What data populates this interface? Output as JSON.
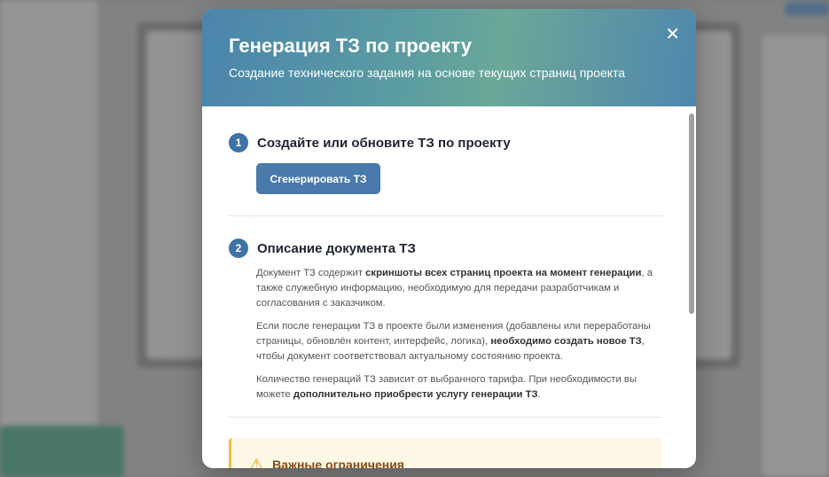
{
  "modal": {
    "title": "Генерация ТЗ по проекту",
    "subtitle": "Создание технического задания на основе текущих страниц проекта",
    "step1": {
      "number": "1",
      "title": "Создайте или обновите ТЗ по проекту",
      "button": "Сгенерировать ТЗ"
    },
    "step2": {
      "number": "2",
      "title": "Описание документа ТЗ",
      "p1": [
        "Документ ТЗ содержит ",
        "скриншоты всех страниц проекта на момент генерации",
        ", а также служебную информацию, необходимую для передачи разработчикам и согласования с заказчиком."
      ],
      "p2": [
        "Если после генерации ТЗ в проекте были изменения (добавлены или переработаны страницы, обновлён контент, интерфейс, логика), ",
        "необходимо создать новое ТЗ",
        ", чтобы документ соответствовал актуальному состоянию проекта."
      ],
      "p3": [
        "Количество генераций ТЗ зависит от выбранного тарифа. При необходимости вы можете ",
        "дополнительно приобрести услугу генерации ТЗ",
        "."
      ]
    },
    "warning": {
      "title": "Важные ограничения"
    }
  }
}
